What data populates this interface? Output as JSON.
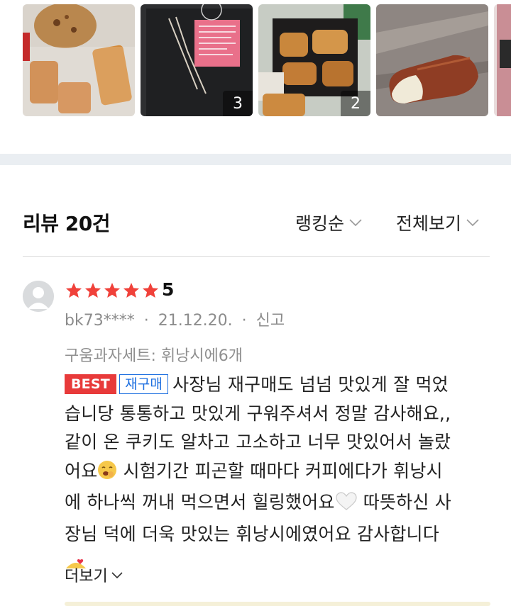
{
  "photos": [
    {
      "kind": "cookies-and-financiers",
      "count": ""
    },
    {
      "kind": "black-gift-box",
      "count": "3"
    },
    {
      "kind": "boxed-financiers",
      "count": "2"
    },
    {
      "kind": "financier-closeup",
      "count": ""
    },
    {
      "kind": "pink-package",
      "count": ""
    }
  ],
  "review_header": {
    "title": "리뷰 20건",
    "sort_label": "랭킹순",
    "filter_label": "전체보기"
  },
  "review": {
    "rating": "5",
    "rating_value": 5,
    "user": "bk73****",
    "date": "21.12.20.",
    "report_label": "신고",
    "option": "구움과자세트: 휘낭시에6개",
    "badge_best": "BEST",
    "badge_repurchase": "재구매",
    "text_line_1": "사장님 재구매도 넘넘 맛있게 잘 먹었",
    "text_line_2": "습니당 통통하고 맛있게 구워주셔서 정말 감사해요,,",
    "text_line_3": "같이 온 쿠키도 알차고 고소하고 너무 맛있어서 놀랐",
    "text_line_4a": "어요",
    "text_line_4b": " 시험기간 피곤할 때마다 커피에다가 휘낭시",
    "text_line_5a": "에 하나씩 꺼내 먹으면서 힐링했어요",
    "text_line_5b": " 따뜻하신 사",
    "text_line_6": "장님 덕에 더욱 맛있는 휘낭시에였어요 감사합니다",
    "more_label": "더보기"
  },
  "colors": {
    "star": "#f0413a",
    "best_badge": "#e83a3a",
    "repurchase_badge": "#1d6fe0",
    "divider": "#eaeef2"
  }
}
